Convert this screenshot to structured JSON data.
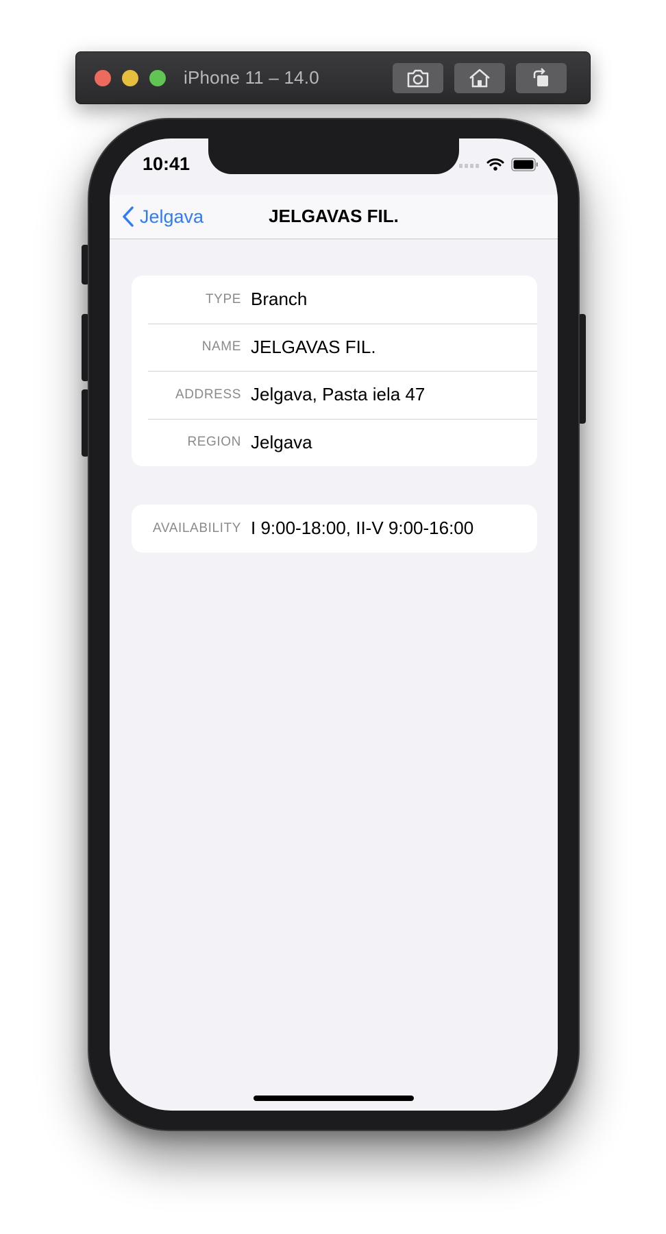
{
  "simulator": {
    "title": "iPhone 11 – 14.0",
    "buttons": [
      {
        "icon": "camera-icon"
      },
      {
        "icon": "home-icon"
      },
      {
        "icon": "rotate-icon"
      }
    ]
  },
  "status_bar": {
    "time": "10:41",
    "icons": [
      "cellular-signal-icon",
      "wifi-icon",
      "battery-icon"
    ]
  },
  "navbar": {
    "back_label": "Jelgava",
    "title": "JELGAVAS FIL."
  },
  "details": {
    "rows": [
      {
        "label": "TYPE",
        "value": "Branch"
      },
      {
        "label": "NAME",
        "value": "JELGAVAS FIL."
      },
      {
        "label": "ADDRESS",
        "value": "Jelgava, Pasta iela 47"
      },
      {
        "label": "REGION",
        "value": "Jelgava"
      }
    ]
  },
  "availability": {
    "label": "AVAILABILITY",
    "value": "I 9:00-18:00, II-V 9:00-16:00"
  },
  "colors": {
    "accent": "#2f7cf6",
    "background": "#f2f2f7",
    "label": "#8a8a8e"
  }
}
